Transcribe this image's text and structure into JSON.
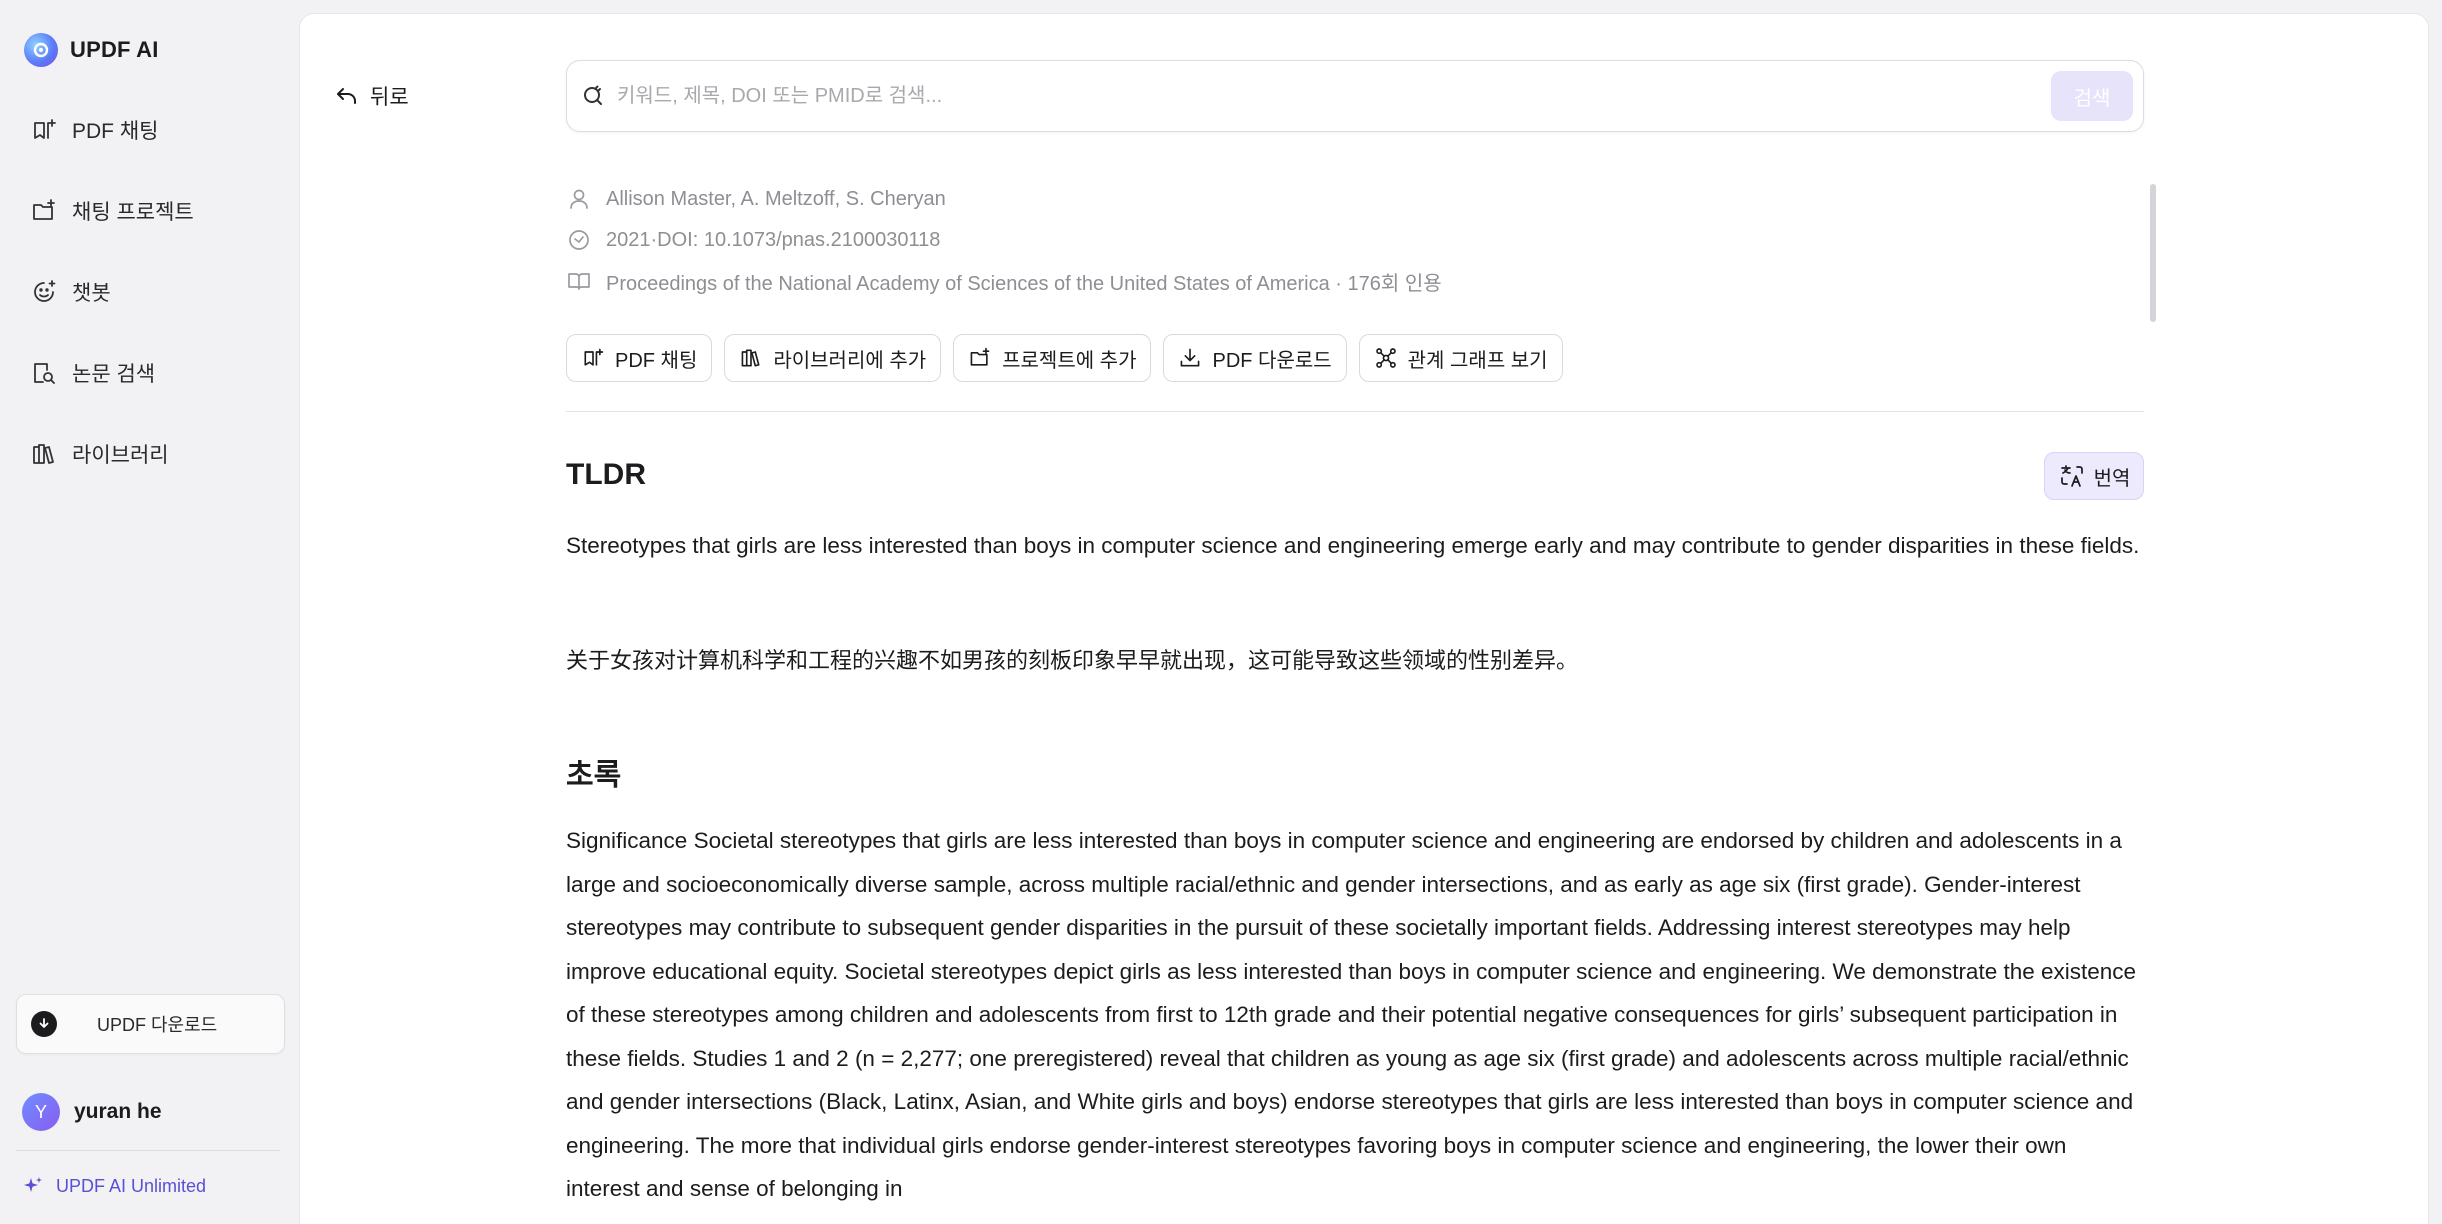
{
  "brand": {
    "name": "UPDF AI"
  },
  "sidebar": {
    "items": [
      {
        "label": "PDF 채팅",
        "icon": "pdf-chat-icon"
      },
      {
        "label": "채팅 프로젝트",
        "icon": "folder-plus-icon"
      },
      {
        "label": "챗봇",
        "icon": "bot-icon"
      },
      {
        "label": "논문 검색",
        "icon": "document-search-icon"
      },
      {
        "label": "라이브러리",
        "icon": "library-icon"
      }
    ],
    "download_label": "UPDF 다운로드",
    "user_initial": "Y",
    "user_name": "yuran he",
    "plan_label": "UPDF AI Unlimited"
  },
  "header": {
    "back_label": "뒤로",
    "search_placeholder": "키워드, 제목, DOI 또는 PMID로 검색...",
    "search_button": "검색"
  },
  "paper": {
    "authors": "Allison Master,  A. Meltzoff,  S. Cheryan",
    "year_doi": "2021·DOI: 10.1073/pnas.2100030118",
    "venue": "Proceedings of the National Academy of Sciences of the United States of America · 176회 인용"
  },
  "actions": [
    {
      "label": "PDF 채팅",
      "icon": "pdf-chat-icon"
    },
    {
      "label": "라이브러리에 추가",
      "icon": "library-icon"
    },
    {
      "label": "프로젝트에 추가",
      "icon": "folder-plus-icon"
    },
    {
      "label": "PDF 다운로드",
      "icon": "download-icon"
    },
    {
      "label": "관계 그래프 보기",
      "icon": "graph-icon"
    }
  ],
  "tldr": {
    "title": "TLDR",
    "translate_label": "번역",
    "text_en": "Stereotypes that girls are less interested than boys in computer science and engineering emerge early and may contribute to gender disparities in these fields.",
    "text_zh": "关于女孩对计算机科学和工程的兴趣不如男孩的刻板印象早早就出现，这可能导致这些领域的性别差异。"
  },
  "abstract": {
    "title": "초록",
    "text": "Significance Societal stereotypes that girls are less interested than boys in computer science and engineering are endorsed by children and adolescents in a large and socioeconomically diverse sample, across multiple racial/ethnic and gender intersections, and as early as age six (first grade). Gender-interest stereotypes may contribute to subsequent gender disparities in the pursuit of these societally important fields. Addressing interest stereotypes may help improve educational equity. Societal stereotypes depict girls as less interested than boys in computer science and engineering. We demonstrate the existence of these stereotypes among children and adolescents from first to 12th grade and their potential negative consequences for girls’ subsequent participation in these fields. Studies 1 and 2 (n = 2,277; one preregistered) reveal that children as young as age six (first grade) and adolescents across multiple racial/ethnic and gender intersections (Black, Latinx, Asian, and White girls and boys) endorse stereotypes that girls are less interested than boys in computer science and engineering. The more that individual girls endorse gender-interest stereotypes favoring boys in computer science and engineering, the lower their own interest and sense of belonging in"
  },
  "colors": {
    "accent": "#5a4fd6",
    "search_button_bg": "#e6e3fb",
    "translate_bg": "#eceafc"
  }
}
